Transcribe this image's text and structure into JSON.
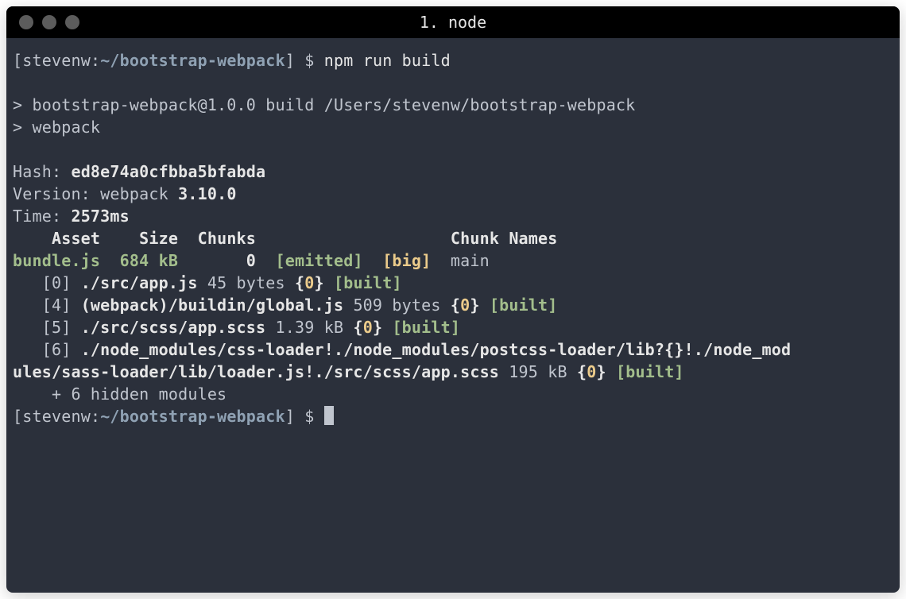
{
  "window": {
    "title": "1. node"
  },
  "prompt1": {
    "open": "[",
    "user": "stevenw",
    "sep": ":",
    "path": "~/bootstrap-webpack",
    "close": "] $ ",
    "command": "npm run build"
  },
  "script": {
    "line1": "> bootstrap-webpack@1.0.0 build /Users/stevenw/bootstrap-webpack",
    "line2": "> webpack"
  },
  "stats": {
    "hashLabel": "Hash: ",
    "hash": "ed8e74a0cfbba5bfabda",
    "versionLabel": "Version: webpack ",
    "version": "3.10.0",
    "timeLabel": "Time: ",
    "time": "2573ms"
  },
  "header": {
    "asset": "    Asset",
    "size": "    Size",
    "chunks": "  Chunks",
    "spacer": "                    ",
    "chunkNames": "Chunk Names"
  },
  "bundle": {
    "name": "bundle.js",
    "size": "  684 kB",
    "chunk": "       0  ",
    "emitted": "[emitted]",
    "gap": "  ",
    "big": "[big]",
    "gap2": "  ",
    "chunkName": "main"
  },
  "modules": {
    "m0": {
      "idx": "   [0] ",
      "path": "./src/app.js",
      "size": " 45 bytes ",
      "brace_open": "{",
      "chunk": "0",
      "brace_close": "}",
      "built": " [built]"
    },
    "m4": {
      "idx": "   [4] ",
      "path": "(webpack)/buildin/global.js",
      "size": " 509 bytes ",
      "brace_open": "{",
      "chunk": "0",
      "brace_close": "}",
      "built": " [built]"
    },
    "m5": {
      "idx": "   [5] ",
      "path": "./src/scss/app.scss",
      "size": " 1.39 kB ",
      "brace_open": "{",
      "chunk": "0",
      "brace_close": "}",
      "built": " [built]"
    },
    "m6": {
      "idx": "   [6] ",
      "path1": "./node_modules/css-loader!./node_modules/postcss-loader/lib?{}!./node_mod",
      "path2": "ules/sass-loader/lib/loader.js!./src/scss/app.scss",
      "size": " 195 kB ",
      "brace_open": "{",
      "chunk": "0",
      "brace_close": "}",
      "built": " [built]"
    },
    "hidden": "    + 6 hidden modules"
  },
  "prompt2": {
    "open": "[",
    "user": "stevenw",
    "sep": ":",
    "path": "~/bootstrap-webpack",
    "close": "] $ "
  }
}
